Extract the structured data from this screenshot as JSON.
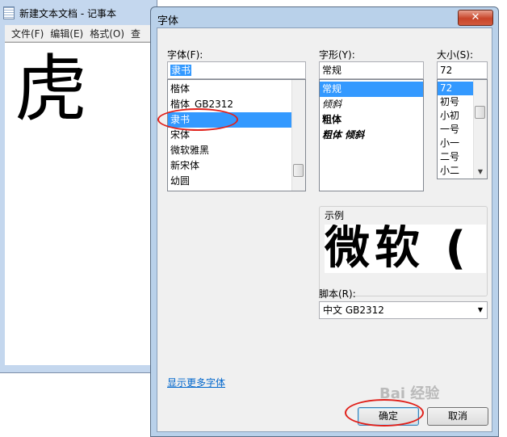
{
  "notepad": {
    "title": "新建文本文档 - 记事本",
    "menu": [
      "文件(F)",
      "编辑(E)",
      "格式(O)",
      "查"
    ],
    "content": "虎"
  },
  "dialog": {
    "title": "字体",
    "close": "✕",
    "font_label": "字体(F):",
    "font_value": "隶书",
    "font_list": [
      "楷体",
      "楷体_GB2312",
      "隶书",
      "宋体",
      "微软雅黑",
      "新宋体",
      "幼圆"
    ],
    "font_selected": "隶书",
    "style_label": "字形(Y):",
    "style_value": "常规",
    "style_list": [
      "常规",
      "倾斜",
      "粗体",
      "粗体 倾斜"
    ],
    "style_selected": "常规",
    "size_label": "大小(S):",
    "size_value": "72",
    "size_list": [
      "72",
      "初号",
      "小初",
      "一号",
      "小一",
      "二号",
      "小二"
    ],
    "size_selected": "72",
    "sample_label": "示例",
    "sample_text": "微软 (",
    "script_label": "脚本(R):",
    "script_value": "中文 GB2312",
    "more_fonts_link": "显示更多字体",
    "ok": "确定",
    "cancel": "取消"
  },
  "watermark": "Bai 经验",
  "colors": {
    "highlight": "#3399ff",
    "annotation_red": "#e0201a",
    "link": "#0066cc"
  }
}
